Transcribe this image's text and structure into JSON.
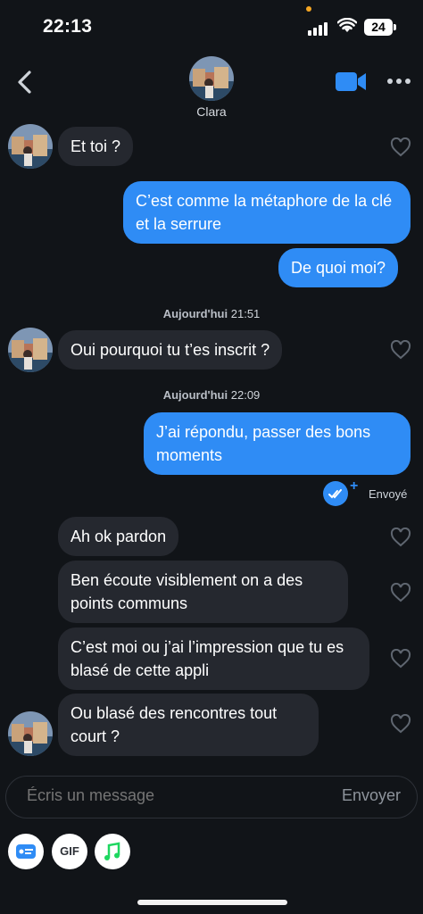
{
  "status_bar": {
    "time": "22:13",
    "battery": "24"
  },
  "header": {
    "name": "Clara"
  },
  "messages": {
    "m1": "Et toi ?",
    "m2": "C’est comme la métaphore de la clé et la serrure",
    "m3": "De quoi moi?",
    "m4": "Oui pourquoi tu t’es inscrit ?",
    "m5": "J’ai répondu, passer des bons moments",
    "m6": "Ah ok pardon",
    "m7": "Ben écoute visiblement on a des points communs",
    "m8": "C’est moi ou j’ai l’impression que tu es blasé de cette appli",
    "m9": "Ou blasé des rencontres tout court ?"
  },
  "timestamps": {
    "t1_day": "Aujourd'hui",
    "t1_time": "21:51",
    "t2_day": "Aujourd'hui",
    "t2_time": "22:09"
  },
  "delivery_status": "Envoyé",
  "composer": {
    "placeholder": "Écris un message",
    "send_label": "Envoyer"
  },
  "toolbar": {
    "gif_label": "GIF"
  },
  "colors": {
    "sent_bubble": "#2f8cf5",
    "received_bubble": "#25282f",
    "background": "#111418"
  }
}
